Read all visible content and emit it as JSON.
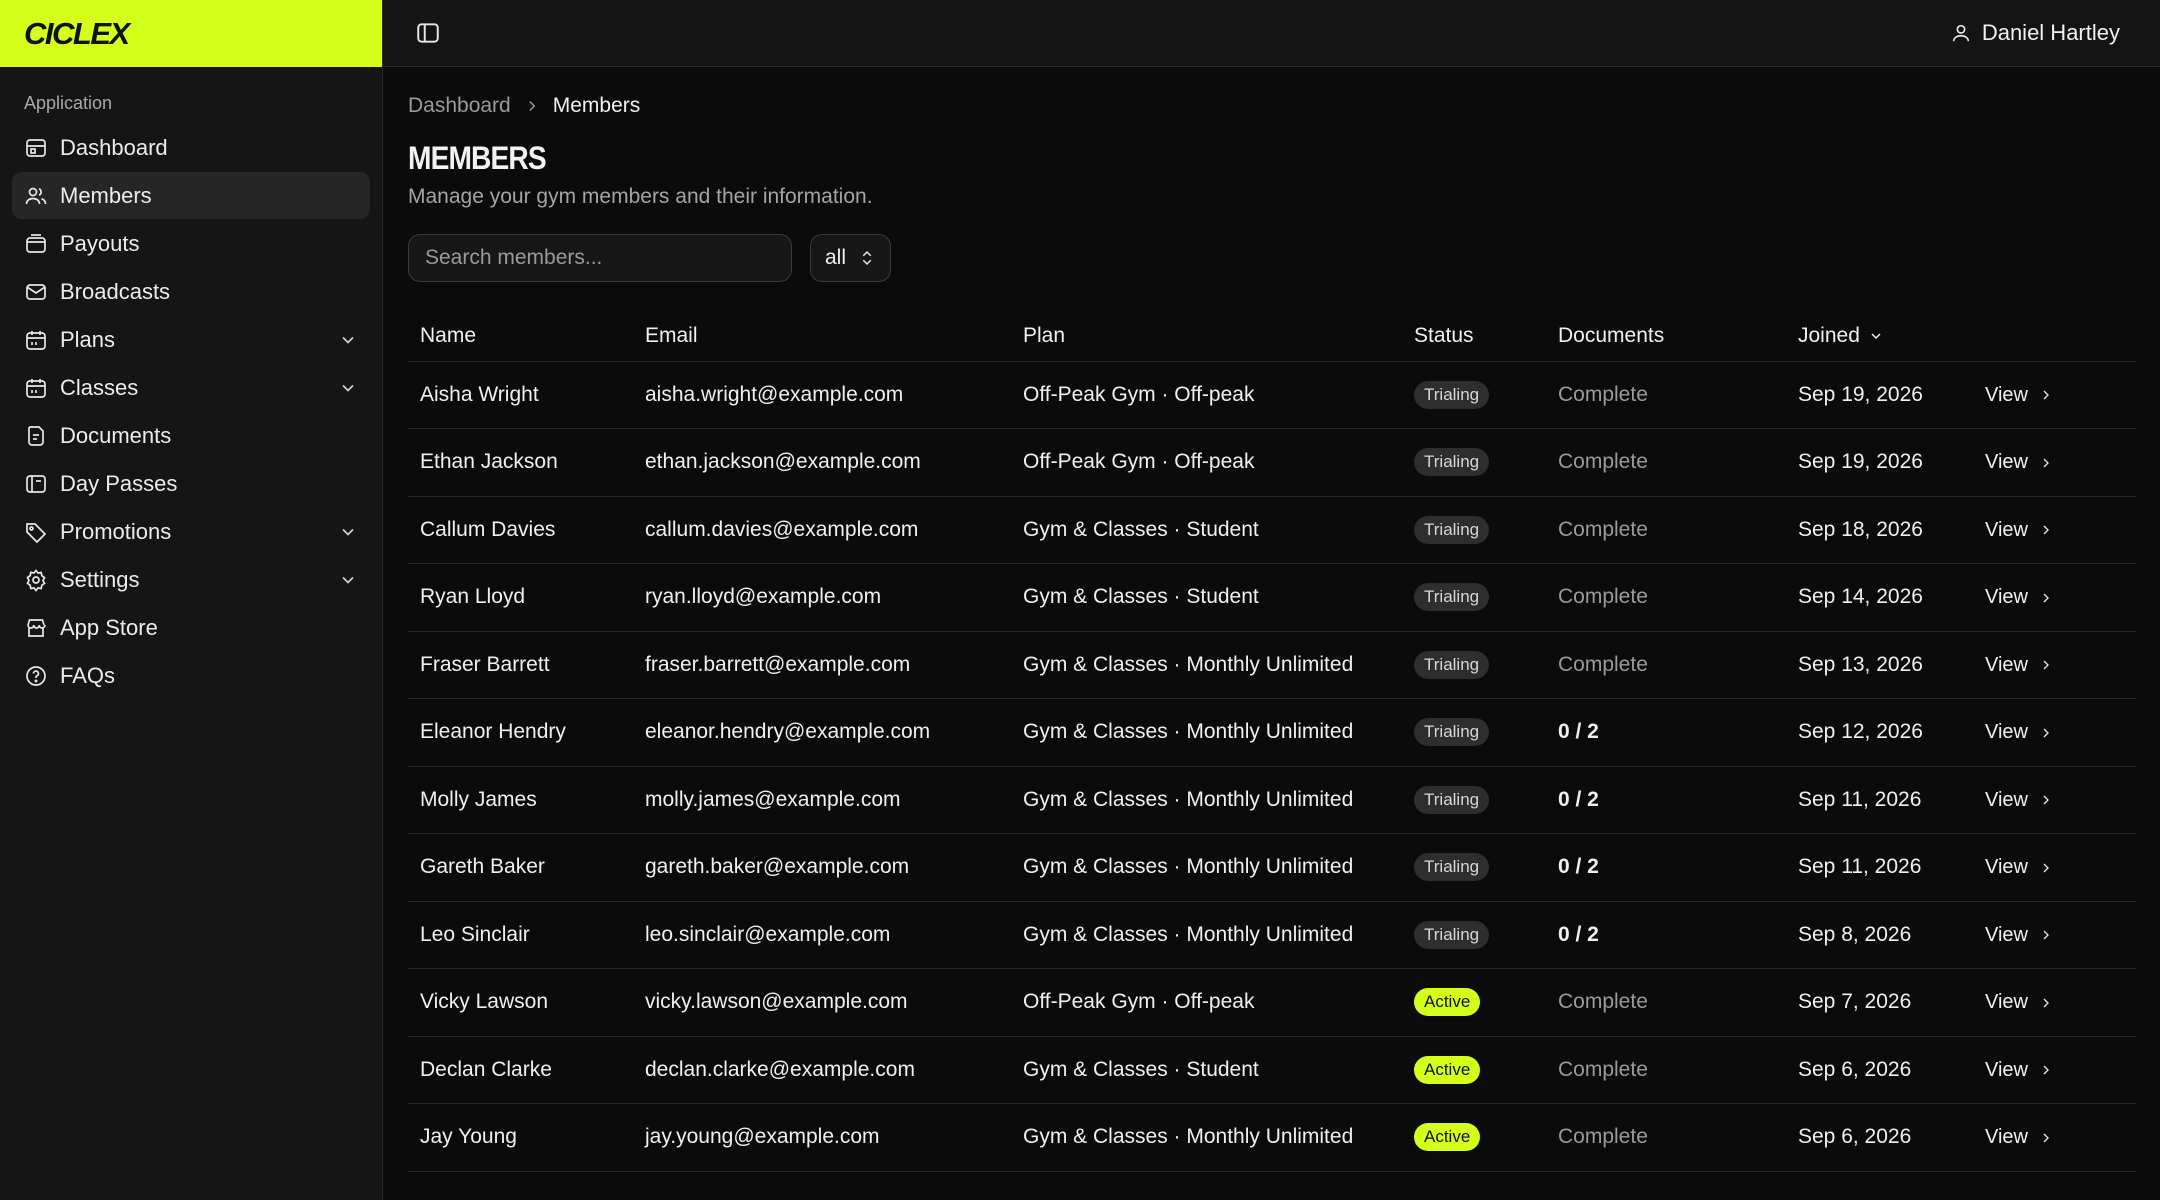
{
  "brand": {
    "name": "CICLEX",
    "accent_color": "#d4ff1a"
  },
  "sidebar": {
    "section": "Application",
    "items": [
      {
        "label": "Dashboard",
        "icon": "dashboard-icon",
        "active": false,
        "expandable": false
      },
      {
        "label": "Members",
        "icon": "users-icon",
        "active": true,
        "expandable": false
      },
      {
        "label": "Payouts",
        "icon": "wallet-icon",
        "active": false,
        "expandable": false
      },
      {
        "label": "Broadcasts",
        "icon": "mail-icon",
        "active": false,
        "expandable": false
      },
      {
        "label": "Plans",
        "icon": "calendar-icon",
        "active": false,
        "expandable": true
      },
      {
        "label": "Classes",
        "icon": "calendar-icon",
        "active": false,
        "expandable": true
      },
      {
        "label": "Documents",
        "icon": "document-icon",
        "active": false,
        "expandable": false
      },
      {
        "label": "Day Passes",
        "icon": "ticket-icon",
        "active": false,
        "expandable": false
      },
      {
        "label": "Promotions",
        "icon": "tag-icon",
        "active": false,
        "expandable": true
      },
      {
        "label": "Settings",
        "icon": "gear-icon",
        "active": false,
        "expandable": true
      },
      {
        "label": "App Store",
        "icon": "store-icon",
        "active": false,
        "expandable": false
      },
      {
        "label": "FAQs",
        "icon": "help-icon",
        "active": false,
        "expandable": false
      }
    ]
  },
  "topbar": {
    "user_name": "Daniel Hartley"
  },
  "breadcrumb": {
    "parent": "Dashboard",
    "current": "Members"
  },
  "page": {
    "title": "MEMBERS",
    "subtitle": "Manage your gym members and their information."
  },
  "filters": {
    "search_placeholder": "Search members...",
    "status_select": "all"
  },
  "table": {
    "headers": {
      "name": "Name",
      "email": "Email",
      "plan": "Plan",
      "status": "Status",
      "documents": "Documents",
      "joined": "Joined"
    },
    "view_label": "View",
    "rows": [
      {
        "name": "Aisha Wright",
        "email": "aisha.wright@example.com",
        "plan": "Off-Peak Gym · Off-peak",
        "status": "Trialing",
        "documents": "Complete",
        "joined": "Sep 19, 2026"
      },
      {
        "name": "Ethan Jackson",
        "email": "ethan.jackson@example.com",
        "plan": "Off-Peak Gym · Off-peak",
        "status": "Trialing",
        "documents": "Complete",
        "joined": "Sep 19, 2026"
      },
      {
        "name": "Callum Davies",
        "email": "callum.davies@example.com",
        "plan": "Gym & Classes · Student",
        "status": "Trialing",
        "documents": "Complete",
        "joined": "Sep 18, 2026"
      },
      {
        "name": "Ryan Lloyd",
        "email": "ryan.lloyd@example.com",
        "plan": "Gym & Classes · Student",
        "status": "Trialing",
        "documents": "Complete",
        "joined": "Sep 14, 2026"
      },
      {
        "name": "Fraser Barrett",
        "email": "fraser.barrett@example.com",
        "plan": "Gym & Classes · Monthly Unlimited",
        "status": "Trialing",
        "documents": "Complete",
        "joined": "Sep 13, 2026"
      },
      {
        "name": "Eleanor Hendry",
        "email": "eleanor.hendry@example.com",
        "plan": "Gym & Classes · Monthly Unlimited",
        "status": "Trialing",
        "documents": "0 / 2",
        "joined": "Sep 12, 2026"
      },
      {
        "name": "Molly James",
        "email": "molly.james@example.com",
        "plan": "Gym & Classes · Monthly Unlimited",
        "status": "Trialing",
        "documents": "0 / 2",
        "joined": "Sep 11, 2026"
      },
      {
        "name": "Gareth Baker",
        "email": "gareth.baker@example.com",
        "plan": "Gym & Classes · Monthly Unlimited",
        "status": "Trialing",
        "documents": "0 / 2",
        "joined": "Sep 11, 2026"
      },
      {
        "name": "Leo Sinclair",
        "email": "leo.sinclair@example.com",
        "plan": "Gym & Classes · Monthly Unlimited",
        "status": "Trialing",
        "documents": "0 / 2",
        "joined": "Sep 8, 2026"
      },
      {
        "name": "Vicky Lawson",
        "email": "vicky.lawson@example.com",
        "plan": "Off-Peak Gym · Off-peak",
        "status": "Active",
        "documents": "Complete",
        "joined": "Sep 7, 2026"
      },
      {
        "name": "Declan Clarke",
        "email": "declan.clarke@example.com",
        "plan": "Gym & Classes · Student",
        "status": "Active",
        "documents": "Complete",
        "joined": "Sep 6, 2026"
      },
      {
        "name": "Jay Young",
        "email": "jay.young@example.com",
        "plan": "Gym & Classes · Monthly Unlimited",
        "status": "Active",
        "documents": "Complete",
        "joined": "Sep 6, 2026"
      }
    ]
  }
}
